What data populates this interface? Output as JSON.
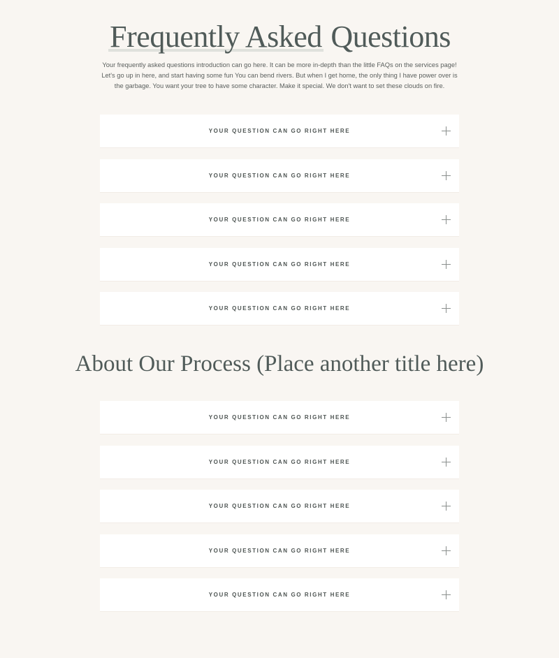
{
  "section1": {
    "title_highlight": "Frequently Asked",
    "title_rest": " Questions",
    "intro": "Your frequently asked questions introduction can go here. It can be more in-depth than the little FAQs on the services page! Let's go up in here, and start having some fun You can bend rivers. But when I get home, the only thing I have power over is the garbage. You want your tree to have some character. Make it special. We don't want to set these clouds on fire.",
    "faqs": [
      {
        "question": "YOUR QUESTION CAN GO RIGHT HERE",
        "icon": "plus-icon"
      },
      {
        "question": "YOUR QUESTION CAN GO RIGHT HERE",
        "icon": "plus-icon"
      },
      {
        "question": "YOUR QUESTION CAN GO RIGHT HERE",
        "icon": "plus-icon"
      },
      {
        "question": "YOUR QUESTION CAN GO RIGHT HERE",
        "icon": "plus-icon"
      },
      {
        "question": "YOUR QUESTION CAN GO RIGHT HERE",
        "icon": "plus-icon"
      }
    ]
  },
  "section2": {
    "title": "About Our Process (Place another title here)",
    "faqs": [
      {
        "question": "YOUR QUESTION CAN GO RIGHT HERE",
        "icon": "plus-icon"
      },
      {
        "question": "YOUR QUESTION CAN GO RIGHT HERE",
        "icon": "plus-icon"
      },
      {
        "question": "YOUR QUESTION CAN GO RIGHT HERE",
        "icon": "plus-icon"
      },
      {
        "question": "YOUR QUESTION CAN GO RIGHT HERE",
        "icon": "plus-icon"
      },
      {
        "question": "YOUR QUESTION CAN GO RIGHT HERE",
        "icon": "plus-icon"
      }
    ]
  },
  "colors": {
    "background": "#f9f6f2",
    "card": "#ffffff",
    "heading": "#505b59",
    "text": "#5a5f5d",
    "highlight": "#dfe1dc"
  }
}
